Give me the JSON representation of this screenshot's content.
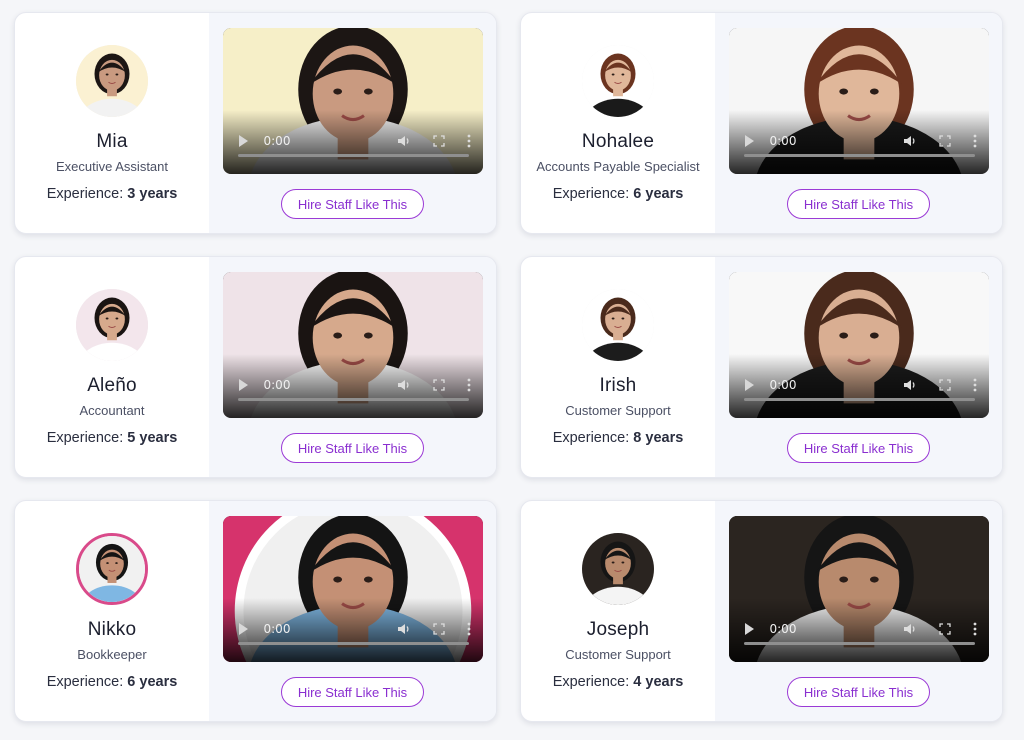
{
  "cards": [
    {
      "name": "Mia",
      "role": "Executive Assistant",
      "experience_label": "Experience:",
      "experience_value": "3 years",
      "video_time": "0:00",
      "hire_label": "Hire Staff Like This",
      "avatar_bg": "#fbf1d2",
      "hair": "#1c1614",
      "skin": "#c99a80",
      "cloth": "#f2f2f2",
      "video_bg": "#f6efc8",
      "ring": false
    },
    {
      "name": "Nohalee",
      "role": "Accounts Payable Specialist",
      "experience_label": "Experience:",
      "experience_value": "6 years",
      "video_time": "0:00",
      "hire_label": "Hire Staff Like This",
      "avatar_bg": "#ffffff",
      "hair": "#6b3420",
      "skin": "#e0b79a",
      "cloth": "#1a1a1a",
      "video_bg": "#f6f6f6",
      "ring": false
    },
    {
      "name": "Aleño",
      "role": "Accountant",
      "experience_label": "Experience:",
      "experience_value": "5 years",
      "video_time": "0:00",
      "hire_label": "Hire Staff Like This",
      "avatar_bg": "#f3e6ec",
      "hair": "#1a1412",
      "skin": "#d6a98c",
      "cloth": "#ffffff",
      "video_bg": "#efe3e8",
      "ring": false
    },
    {
      "name": "Irish",
      "role": "Customer Support",
      "experience_label": "Experience:",
      "experience_value": "8 years",
      "video_time": "0:00",
      "hire_label": "Hire Staff Like This",
      "avatar_bg": "#ffffff",
      "hair": "#4a2a1c",
      "skin": "#d9ae92",
      "cloth": "#1c1c1c",
      "video_bg": "#f8f8f8",
      "ring": false
    },
    {
      "name": "Nikko",
      "role": "Bookkeeper",
      "experience_label": "Experience:",
      "experience_value": "6 years",
      "video_time": "0:00",
      "hire_label": "Hire Staff Like This",
      "avatar_bg": "#f1f1f1",
      "hair": "#141414",
      "skin": "#c49075",
      "cloth": "#7fb7e3",
      "video_bg": "#d6336c",
      "ring": true
    },
    {
      "name": "Joseph",
      "role": "Customer Support",
      "experience_label": "Experience:",
      "experience_value": "4 years",
      "video_time": "0:00",
      "hire_label": "Hire Staff Like This",
      "avatar_bg": "#2a2420",
      "hair": "#151515",
      "skin": "#b88a6d",
      "cloth": "#f4f4f4",
      "video_bg": "#2b2520",
      "ring": false
    }
  ]
}
